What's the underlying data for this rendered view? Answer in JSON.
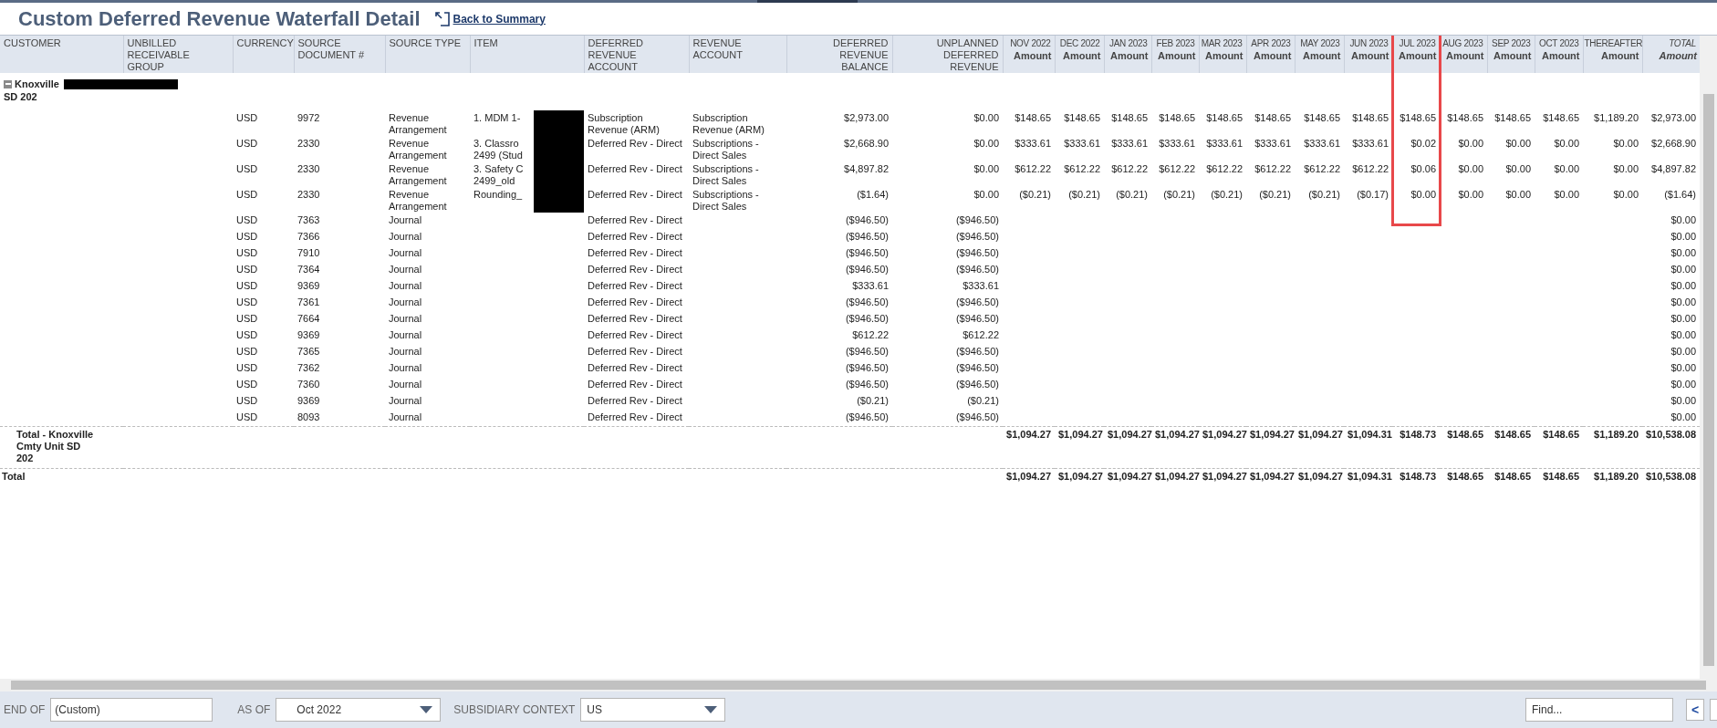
{
  "title": "Custom Deferred Revenue Waterfall Detail",
  "back_link": "Back to Summary",
  "columns": [
    {
      "label": "CUSTOMER"
    },
    {
      "label": "UNBILLED RECEIVABLE GROUP"
    },
    {
      "label": "CURRENCY"
    },
    {
      "label": "SOURCE DOCUMENT #"
    },
    {
      "label": "SOURCE TYPE"
    },
    {
      "label": "ITEM"
    },
    {
      "label": "DEFERRED REVENUE ACCOUNT"
    },
    {
      "label": "REVENUE ACCOUNT"
    },
    {
      "label": "DEFERRED REVENUE BALANCE"
    },
    {
      "label": "UNPLANNED DEFERRED REVENUE"
    },
    {
      "label": "NOV 2022",
      "sublabel": "Amount"
    },
    {
      "label": "DEC 2022",
      "sublabel": "Amount"
    },
    {
      "label": "JAN 2023",
      "sublabel": "Amount"
    },
    {
      "label": "FEB 2023",
      "sublabel": "Amount"
    },
    {
      "label": "MAR 2023",
      "sublabel": "Amount"
    },
    {
      "label": "APR 2023",
      "sublabel": "Amount"
    },
    {
      "label": "MAY 2023",
      "sublabel": "Amount"
    },
    {
      "label": "JUN 2023",
      "sublabel": "Amount"
    },
    {
      "label": "JUL 2023",
      "sublabel": "Amount"
    },
    {
      "label": "AUG 2023",
      "sublabel": "Amount"
    },
    {
      "label": "SEP 2023",
      "sublabel": "Amount"
    },
    {
      "label": "OCT 2023",
      "sublabel": "Amount"
    },
    {
      "label": "THEREAFTER",
      "sublabel": "Amount"
    },
    {
      "label": "TOTAL",
      "sublabel": "Amount"
    }
  ],
  "group": {
    "expanded": true,
    "customer": "Knoxville",
    "customer_redacted": true,
    "customer_line2": "SD 202"
  },
  "rows": [
    {
      "currency": "USD",
      "source_document": "9972",
      "source_type": "Revenue Arrangement",
      "item_lines": [
        "1. MDM 1-"
      ],
      "item_redacted": true,
      "deferred_revenue_account": "Subscription Revenue (ARM)",
      "revenue_account": "Subscription Revenue (ARM)",
      "deferred_revenue_balance": "$2,973.00",
      "unplanned_deferred_revenue": "$0.00",
      "amounts": [
        "$148.65",
        "$148.65",
        "$148.65",
        "$148.65",
        "$148.65",
        "$148.65",
        "$148.65",
        "$148.65",
        "$148.65",
        "$148.65",
        "$148.65",
        "$148.65",
        "$1,189.20"
      ],
      "total": "$2,973.00"
    },
    {
      "currency": "USD",
      "source_document": "2330",
      "source_type": "Revenue Arrangement",
      "item_lines": [
        "3. Classro",
        "2499 (Stud"
      ],
      "item_redacted": true,
      "deferred_revenue_account": "Deferred Rev - Direct",
      "revenue_account": "Subscriptions - Direct Sales",
      "deferred_revenue_balance": "$2,668.90",
      "unplanned_deferred_revenue": "$0.00",
      "amounts": [
        "$333.61",
        "$333.61",
        "$333.61",
        "$333.61",
        "$333.61",
        "$333.61",
        "$333.61",
        "$333.61",
        "$0.02",
        "$0.00",
        "$0.00",
        "$0.00",
        "$0.00"
      ],
      "total": "$2,668.90"
    },
    {
      "currency": "USD",
      "source_document": "2330",
      "source_type": "Revenue Arrangement",
      "item_lines": [
        "3. Safety C",
        "2499_old"
      ],
      "item_redacted": true,
      "deferred_revenue_account": "Deferred Rev - Direct",
      "revenue_account": "Subscriptions - Direct Sales",
      "deferred_revenue_balance": "$4,897.82",
      "unplanned_deferred_revenue": "$0.00",
      "amounts": [
        "$612.22",
        "$612.22",
        "$612.22",
        "$612.22",
        "$612.22",
        "$612.22",
        "$612.22",
        "$612.22",
        "$0.06",
        "$0.00",
        "$0.00",
        "$0.00",
        "$0.00"
      ],
      "total": "$4,897.82"
    },
    {
      "currency": "USD",
      "source_document": "2330",
      "source_type": "Revenue Arrangement",
      "item_lines": [
        "Rounding_"
      ],
      "item_redacted": true,
      "deferred_revenue_account": "Deferred Rev - Direct",
      "revenue_account": "Subscriptions - Direct Sales",
      "deferred_revenue_balance": "($1.64)",
      "unplanned_deferred_revenue": "$0.00",
      "amounts": [
        "($0.21)",
        "($0.21)",
        "($0.21)",
        "($0.21)",
        "($0.21)",
        "($0.21)",
        "($0.21)",
        "($0.17)",
        "$0.00",
        "$0.00",
        "$0.00",
        "$0.00",
        "$0.00"
      ],
      "total": "($1.64)"
    },
    {
      "currency": "USD",
      "source_document": "7363",
      "source_type": "Journal",
      "deferred_revenue_account": "Deferred Rev - Direct",
      "deferred_revenue_balance": "($946.50)",
      "unplanned_deferred_revenue": "($946.50)",
      "total": "$0.00"
    },
    {
      "currency": "USD",
      "source_document": "7366",
      "source_type": "Journal",
      "deferred_revenue_account": "Deferred Rev - Direct",
      "deferred_revenue_balance": "($946.50)",
      "unplanned_deferred_revenue": "($946.50)",
      "total": "$0.00"
    },
    {
      "currency": "USD",
      "source_document": "7910",
      "source_type": "Journal",
      "deferred_revenue_account": "Deferred Rev - Direct",
      "deferred_revenue_balance": "($946.50)",
      "unplanned_deferred_revenue": "($946.50)",
      "total": "$0.00"
    },
    {
      "currency": "USD",
      "source_document": "7364",
      "source_type": "Journal",
      "deferred_revenue_account": "Deferred Rev - Direct",
      "deferred_revenue_balance": "($946.50)",
      "unplanned_deferred_revenue": "($946.50)",
      "total": "$0.00"
    },
    {
      "currency": "USD",
      "source_document": "9369",
      "source_type": "Journal",
      "deferred_revenue_account": "Deferred Rev - Direct",
      "deferred_revenue_balance": "$333.61",
      "unplanned_deferred_revenue": "$333.61",
      "total": "$0.00"
    },
    {
      "currency": "USD",
      "source_document": "7361",
      "source_type": "Journal",
      "deferred_revenue_account": "Deferred Rev - Direct",
      "deferred_revenue_balance": "($946.50)",
      "unplanned_deferred_revenue": "($946.50)",
      "total": "$0.00"
    },
    {
      "currency": "USD",
      "source_document": "7664",
      "source_type": "Journal",
      "deferred_revenue_account": "Deferred Rev - Direct",
      "deferred_revenue_balance": "($946.50)",
      "unplanned_deferred_revenue": "($946.50)",
      "total": "$0.00"
    },
    {
      "currency": "USD",
      "source_document": "9369",
      "source_type": "Journal",
      "deferred_revenue_account": "Deferred Rev - Direct",
      "deferred_revenue_balance": "$612.22",
      "unplanned_deferred_revenue": "$612.22",
      "total": "$0.00"
    },
    {
      "currency": "USD",
      "source_document": "7365",
      "source_type": "Journal",
      "deferred_revenue_account": "Deferred Rev - Direct",
      "deferred_revenue_balance": "($946.50)",
      "unplanned_deferred_revenue": "($946.50)",
      "total": "$0.00"
    },
    {
      "currency": "USD",
      "source_document": "7362",
      "source_type": "Journal",
      "deferred_revenue_account": "Deferred Rev - Direct",
      "deferred_revenue_balance": "($946.50)",
      "unplanned_deferred_revenue": "($946.50)",
      "total": "$0.00"
    },
    {
      "currency": "USD",
      "source_document": "7360",
      "source_type": "Journal",
      "deferred_revenue_account": "Deferred Rev - Direct",
      "deferred_revenue_balance": "($946.50)",
      "unplanned_deferred_revenue": "($946.50)",
      "total": "$0.00"
    },
    {
      "currency": "USD",
      "source_document": "9369",
      "source_type": "Journal",
      "deferred_revenue_account": "Deferred Rev - Direct",
      "deferred_revenue_balance": "($0.21)",
      "unplanned_deferred_revenue": "($0.21)",
      "total": "$0.00"
    },
    {
      "currency": "USD",
      "source_document": "8093",
      "source_type": "Journal",
      "deferred_revenue_account": "Deferred Rev - Direct",
      "deferred_revenue_balance": "($946.50)",
      "unplanned_deferred_revenue": "($946.50)",
      "total": "$0.00"
    }
  ],
  "totals": [
    {
      "label": "Total - Knoxville Cmty Unit SD 202",
      "amounts": [
        "$1,094.27",
        "$1,094.27",
        "$1,094.27",
        "$1,094.27",
        "$1,094.27",
        "$1,094.27",
        "$1,094.27",
        "$1,094.31",
        "$148.73",
        "$148.65",
        "$148.65",
        "$148.65",
        "$1,189.20"
      ],
      "total": "$10,538.08"
    },
    {
      "label": "Total",
      "amounts": [
        "$1,094.27",
        "$1,094.27",
        "$1,094.27",
        "$1,094.27",
        "$1,094.27",
        "$1,094.27",
        "$1,094.27",
        "$1,094.31",
        "$148.73",
        "$148.65",
        "$148.65",
        "$148.65",
        "$1,189.20"
      ],
      "total": "$10,538.08"
    }
  ],
  "footer": {
    "end_of_label": "END OF",
    "end_of_value": "(Custom)",
    "as_of_label": "AS OF",
    "as_of_value": "Oct 2022",
    "subsidiary_label": "SUBSIDIARY CONTEXT",
    "subsidiary_value": "US",
    "find_placeholder": "Find...",
    "prev_button": "<"
  }
}
